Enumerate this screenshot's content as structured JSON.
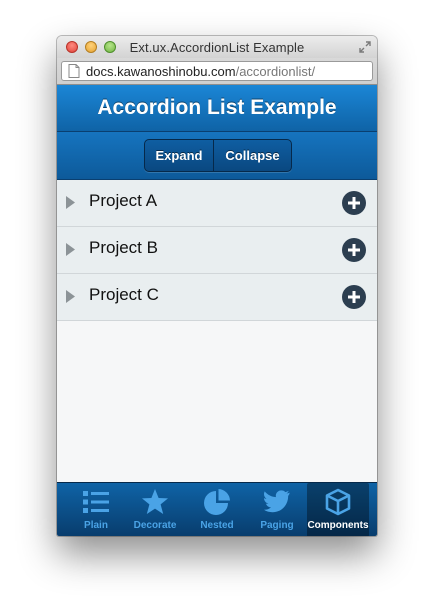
{
  "window": {
    "title": "Ext.ux.AccordionList Example",
    "url_host": "docs.kawanoshinobu.com",
    "url_path": "/accordionlist/"
  },
  "app": {
    "title": "Accordion List Example",
    "toolbar": {
      "expand_label": "Expand",
      "collapse_label": "Collapse"
    },
    "items": [
      {
        "label": "Project A",
        "icon": "plus-circle-icon"
      },
      {
        "label": "Project B",
        "icon": "plus-circle-icon"
      },
      {
        "label": "Project C",
        "icon": "plus-circle-icon"
      }
    ],
    "tabs": [
      {
        "label": "Plain",
        "icon": "list-icon"
      },
      {
        "label": "Decorate",
        "icon": "star-icon"
      },
      {
        "label": "Nested",
        "icon": "pie-chart-icon"
      },
      {
        "label": "Paging",
        "icon": "bird-icon"
      },
      {
        "label": "Components",
        "icon": "cube-icon",
        "active": true
      }
    ]
  },
  "colors": {
    "header_blue": "#1b86d6",
    "tab_inactive": "#4aa3e6",
    "plus_icon": "#2c3e50"
  }
}
